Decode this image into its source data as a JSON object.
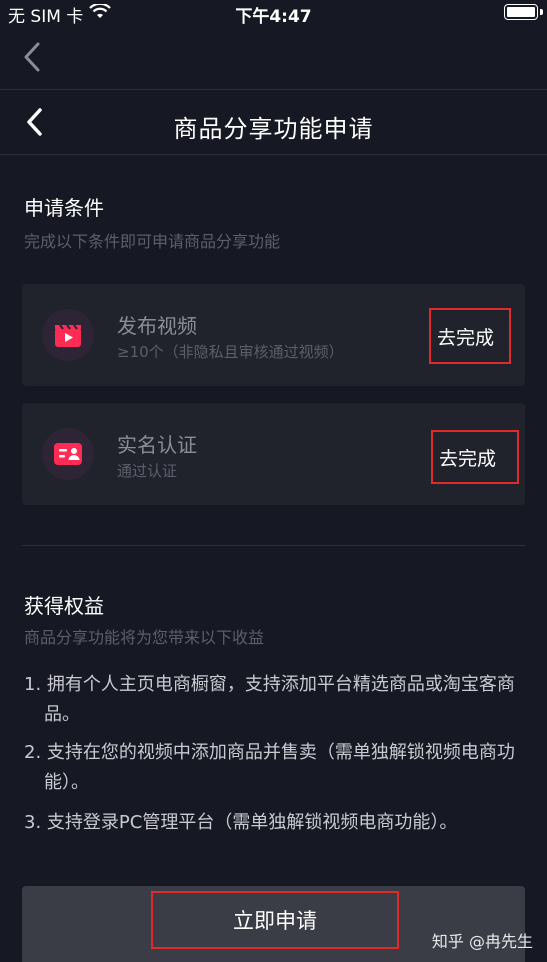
{
  "status_bar": {
    "carrier": "无 SIM 卡",
    "time": "下午4:47",
    "icons": [
      "wifi-icon",
      "battery-icon"
    ]
  },
  "nav": {
    "outer_back_icon": "chevron-left-icon",
    "back_icon": "chevron-left-icon",
    "title": "商品分享功能申请"
  },
  "conditions": {
    "title": "申请条件",
    "subtitle": "完成以下条件即可申请商品分享功能",
    "items": [
      {
        "icon": "video-clapper-icon",
        "title": "发布视频",
        "desc": "≥10个（非隐私且审核通过视频）",
        "action": "去完成"
      },
      {
        "icon": "id-card-icon",
        "title": "实名认证",
        "desc": "通过认证",
        "action": "去完成"
      }
    ]
  },
  "benefits": {
    "title": "获得权益",
    "subtitle": "商品分享功能将为您带来以下收益",
    "items": [
      "1. 拥有个人主页电商橱窗，支持添加平台精选商品或淘宝客商品。",
      "2. 支持在您的视频中添加商品并售卖（需单独解锁视频电商功能）。",
      "3. 支持登录PC管理平台（需单独解锁视频电商功能）。"
    ]
  },
  "apply_button": "立即申请",
  "watermark": "知乎 @冉先生",
  "colors": {
    "background": "#161823",
    "card": "#20222c",
    "accent": "#fe2c55",
    "highlight_border": "#e12a2a"
  }
}
